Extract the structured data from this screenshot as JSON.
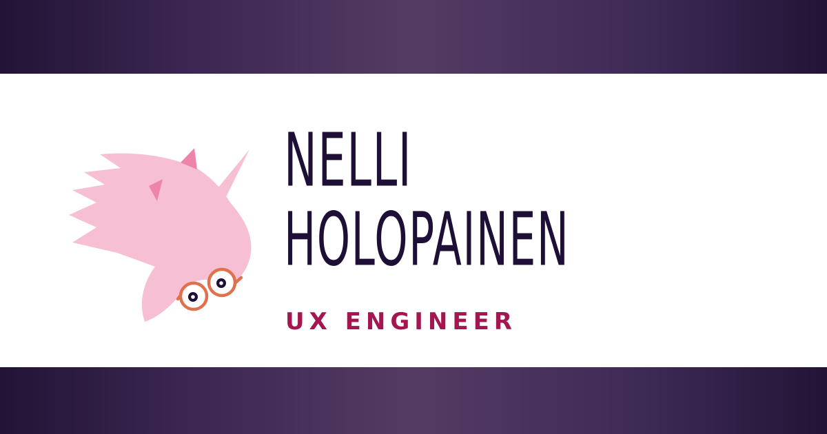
{
  "header": {
    "first_name": "NELLI",
    "last_name": "HOLOPAINEN",
    "role": "UX ENGINEER"
  },
  "logo": {
    "icon": "unicorn-with-glasses-icon"
  },
  "colors": {
    "band_dark": "#221436",
    "band_light": "#543b63",
    "name_text": "#1d0f35",
    "role_text": "#a3164f",
    "unicorn_pink": "#f6bfd4",
    "ear_pink": "#ee84ab",
    "glasses": "#e0714f"
  }
}
